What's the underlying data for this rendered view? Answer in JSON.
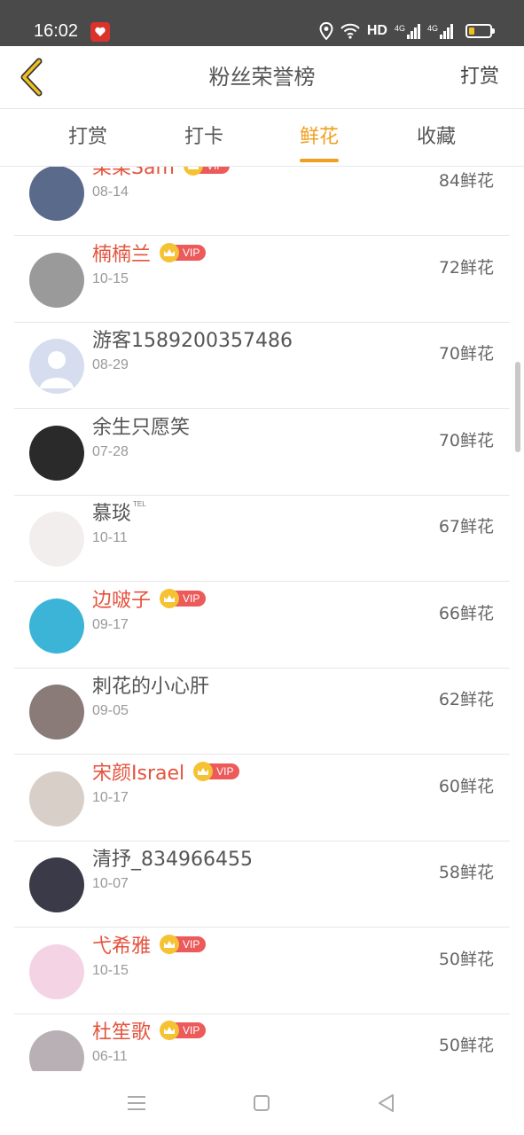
{
  "status_bar": {
    "time": "16:02",
    "hd": "HD",
    "net1": "4G",
    "net2": "4G"
  },
  "header": {
    "title": "粉丝荣誉榜",
    "action": "打赏"
  },
  "tabs": [
    {
      "label": "打赏",
      "active": false
    },
    {
      "label": "打卡",
      "active": false
    },
    {
      "label": "鲜花",
      "active": true
    },
    {
      "label": "收藏",
      "active": false
    }
  ],
  "fans": [
    {
      "name": "柒柒Sam",
      "vip": true,
      "date": "08-14",
      "count": "84鲜花",
      "avatar_color": "#5a6a8a"
    },
    {
      "name": "楠楠兰",
      "vip": true,
      "date": "10-15",
      "count": "72鲜花",
      "avatar_color": "#9a9a9a"
    },
    {
      "name": "游客1589200357486",
      "vip": false,
      "date": "08-29",
      "count": "70鲜花",
      "avatar_color": "#d6ddef"
    },
    {
      "name": "余生只愿笑",
      "vip": false,
      "date": "07-28",
      "count": "70鲜花",
      "avatar_color": "#2a2a2a"
    },
    {
      "name": "慕琰",
      "vip": false,
      "tag": "TEL",
      "date": "10-11",
      "count": "67鲜花",
      "avatar_color": "#f2eeee"
    },
    {
      "name": "边啵子",
      "vip": true,
      "date": "09-17",
      "count": "66鲜花",
      "avatar_color": "#3bb4d8"
    },
    {
      "name": "刺花的小心肝",
      "vip": false,
      "date": "09-05",
      "count": "62鲜花",
      "avatar_color": "#8a7a78"
    },
    {
      "name": "宋颜Israel",
      "vip": true,
      "date": "10-17",
      "count": "60鲜花",
      "avatar_color": "#d8d0c8"
    },
    {
      "name": "清抒_834966455",
      "vip": false,
      "date": "10-07",
      "count": "58鲜花",
      "avatar_color": "#3a3a48"
    },
    {
      "name": "弋希雅",
      "vip": true,
      "date": "10-15",
      "count": "50鲜花",
      "avatar_color": "#f4d4e4"
    },
    {
      "name": "杜笙歌",
      "vip": true,
      "date": "06-11",
      "count": "50鲜花",
      "avatar_color": "#b8b0b4"
    }
  ],
  "vip_label": "VIP",
  "colors": {
    "accent": "#f0a020",
    "vip_name": "#e5533d",
    "vip_pill": "#ec5a5a",
    "crown": "#f5c233"
  }
}
